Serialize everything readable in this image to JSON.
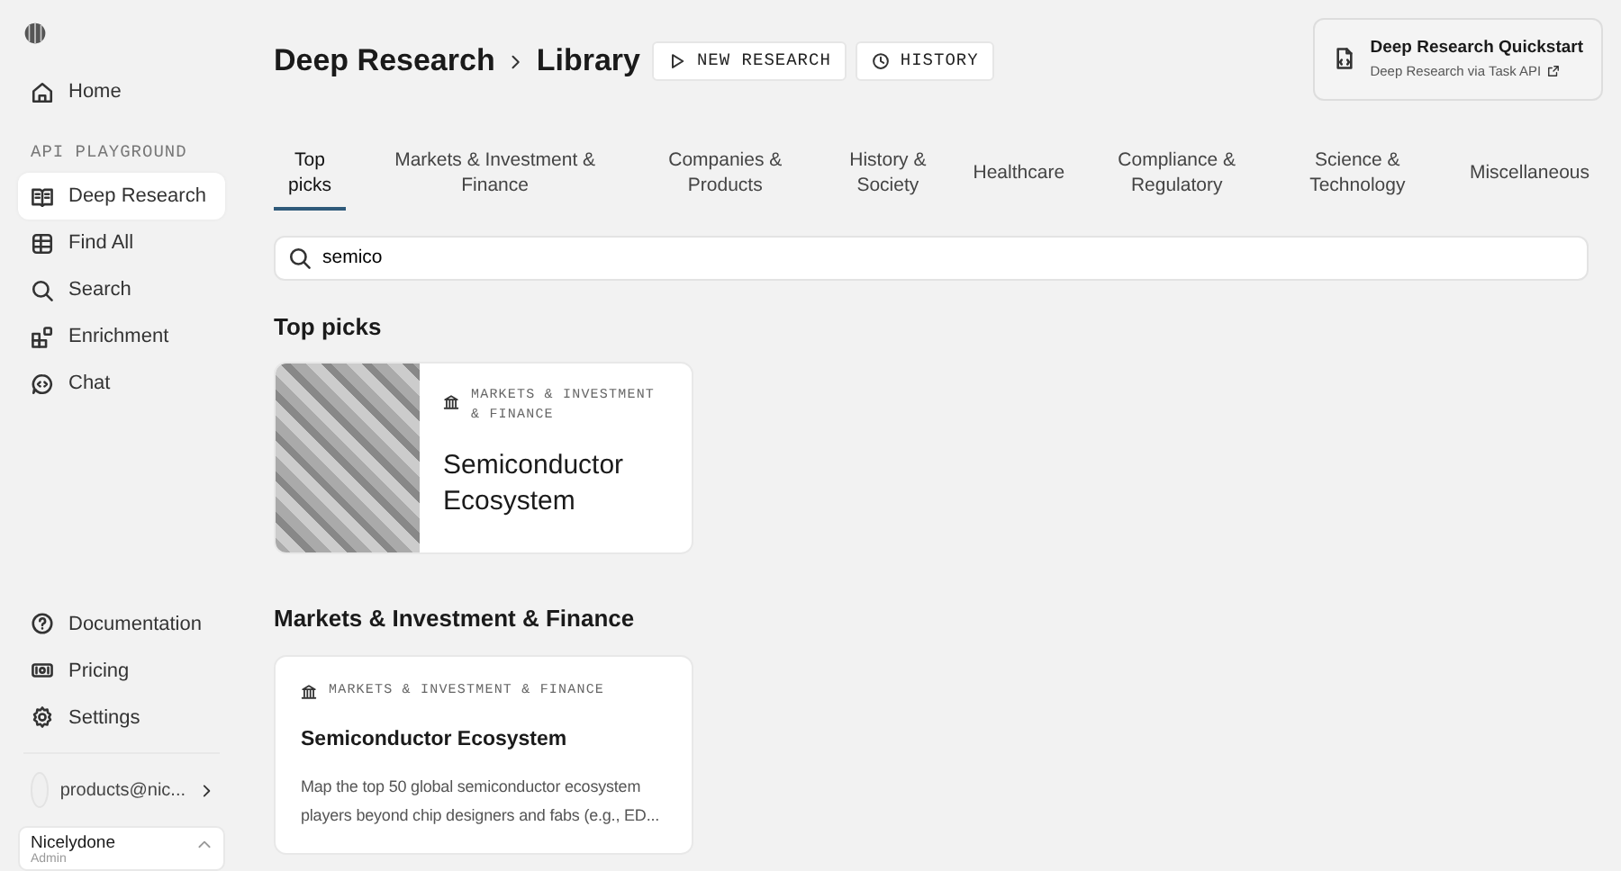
{
  "sidebar": {
    "nav_top": [
      {
        "label": "Home",
        "selected": false
      }
    ],
    "section_label": "API PLAYGROUND",
    "playground": [
      {
        "label": "Deep Research",
        "selected": true
      },
      {
        "label": "Find All",
        "selected": false
      },
      {
        "label": "Search",
        "selected": false
      },
      {
        "label": "Enrichment",
        "selected": false
      },
      {
        "label": "Chat",
        "selected": false
      }
    ],
    "nav_bottom": [
      {
        "label": "Documentation",
        "selected": false
      },
      {
        "label": "Pricing",
        "selected": false
      },
      {
        "label": "Settings",
        "selected": false
      }
    ],
    "account": {
      "email": "products@nic..."
    },
    "workspace": {
      "name": "Nicelydone",
      "role": "Admin"
    }
  },
  "header": {
    "breadcrumb": [
      "Deep Research",
      "Library"
    ],
    "buttons": [
      "NEW RESEARCH",
      "HISTORY"
    ],
    "quickstart": {
      "title": "Deep Research Quickstart",
      "link": "Deep Research via Task API"
    }
  },
  "tabs": [
    {
      "label": "Top picks",
      "selected": true
    },
    {
      "label": "Markets & Investment & Finance",
      "selected": false
    },
    {
      "label": "Companies & Products",
      "selected": false
    },
    {
      "label": "History & Society",
      "selected": false
    },
    {
      "label": "Healthcare",
      "selected": false
    },
    {
      "label": "Compliance & Regulatory",
      "selected": false
    },
    {
      "label": "Science & Technology",
      "selected": false
    },
    {
      "label": "Miscellaneous",
      "selected": false
    }
  ],
  "search": {
    "value": "semico"
  },
  "sections": [
    {
      "title": "Top picks",
      "kind": "featured",
      "cards": [
        {
          "category": "MARKETS & INVESTMENT & FINANCE",
          "title": "Semiconductor Ecosystem"
        }
      ]
    },
    {
      "title": "Markets & Investment & Finance",
      "kind": "list",
      "cards": [
        {
          "category": "MARKETS & INVESTMENT & FINANCE",
          "title": "Semiconductor Ecosystem",
          "description": "Map the top 50 global semiconductor ecosystem players beyond chip designers and fabs (e.g., ED..."
        }
      ]
    }
  ]
}
